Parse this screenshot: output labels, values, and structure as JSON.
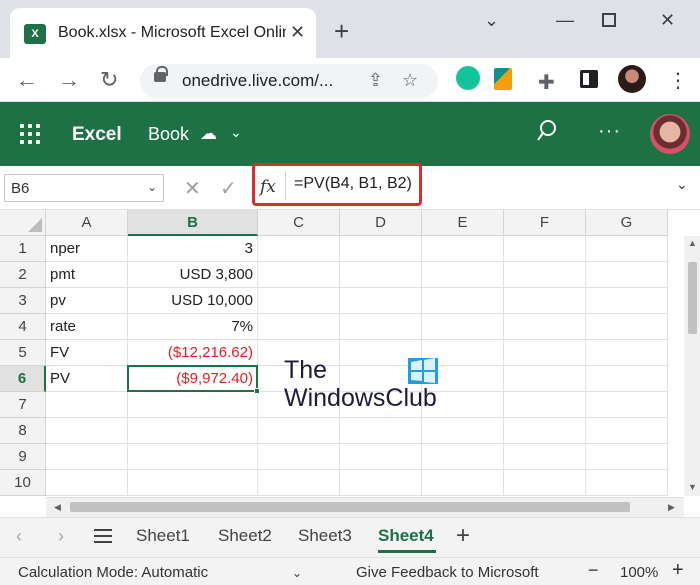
{
  "browser": {
    "tab_title": "Book.xlsx - Microsoft Excel Online",
    "favicon_text": "X",
    "url": "onedrive.live.com/...",
    "icons": [
      "back-arrow-icon",
      "forward-arrow-icon",
      "reload-icon",
      "lock-icon",
      "share-icon",
      "star-icon",
      "grammarly-icon",
      "bing-icon",
      "extensions-icon",
      "sidepanel-icon",
      "profile-icon",
      "menu-icon"
    ]
  },
  "app_bar": {
    "app_name": "Excel",
    "book_name": "Book",
    "accent": "#1e7145"
  },
  "formula_bar": {
    "name_box": "B6",
    "fx_label": "fx",
    "formula": "=PV(B4, B1, B2)",
    "highlight_color": "#d4312b"
  },
  "grid": {
    "columns": [
      "A",
      "B",
      "C",
      "D",
      "E",
      "F",
      "G"
    ],
    "active_column": "B",
    "rows": [
      {
        "num": "1",
        "a": "nper",
        "b": "3"
      },
      {
        "num": "2",
        "a": "pmt",
        "b": "USD 3,800"
      },
      {
        "num": "3",
        "a": "pv",
        "b": "USD 10,000"
      },
      {
        "num": "4",
        "a": "rate",
        "b": "7%"
      },
      {
        "num": "5",
        "a": "FV",
        "b": "($12,216.62)"
      },
      {
        "num": "6",
        "a": "PV",
        "b": "($9,972.40)"
      },
      {
        "num": "7",
        "a": "",
        "b": ""
      },
      {
        "num": "8",
        "a": "",
        "b": ""
      },
      {
        "num": "9",
        "a": "",
        "b": ""
      },
      {
        "num": "10",
        "a": "",
        "b": ""
      }
    ],
    "negative_color": "#e0211c"
  },
  "watermark": {
    "line1": "The",
    "line2": "WindowsClub"
  },
  "sheets": {
    "tabs": [
      "Sheet1",
      "Sheet2",
      "Sheet3",
      "Sheet4"
    ],
    "active": "Sheet4",
    "add_label": "+"
  },
  "status_bar": {
    "calc_mode": "Calculation Mode: Automatic",
    "feedback": "Give Feedback to Microsoft",
    "zoom": "100%"
  }
}
